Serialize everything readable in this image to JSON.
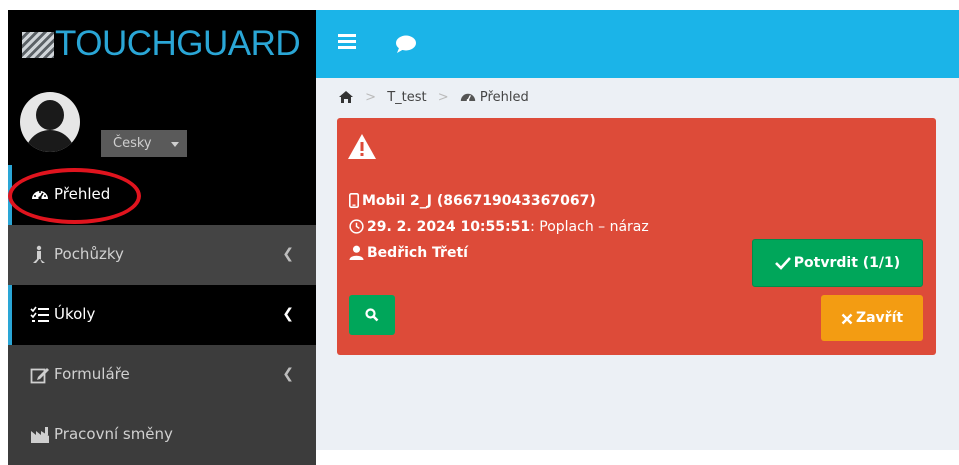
{
  "brand": {
    "name": "TOUCHGUARD"
  },
  "user": {
    "language": "Česky"
  },
  "sidebar": {
    "items": [
      {
        "label": "Přehled",
        "icon": "dashboard-icon",
        "active": true
      },
      {
        "label": "Pochůzky",
        "icon": "walker-icon"
      },
      {
        "label": "Úkoly",
        "icon": "tasks-icon",
        "active": true
      },
      {
        "label": "Formuláře",
        "icon": "edit-icon"
      },
      {
        "label": "Pracovní směny",
        "icon": "chart-icon"
      }
    ]
  },
  "breadcrumb": {
    "home_icon": "home-icon",
    "items": [
      "T_test",
      "Přehled"
    ]
  },
  "alert": {
    "device": "Mobil 2_J (866719043367067)",
    "timestamp": "29. 2. 2024 10:55:51",
    "event": ": Poplach – náraz",
    "person": "Bedřich Třetí",
    "confirm_label": "Potvrdit (1/1)",
    "close_label": "Zavřít"
  },
  "colors": {
    "topbar": "#1bb4e8",
    "alert": "#dd4b39",
    "confirm": "#00a65a",
    "close": "#f39c12",
    "highlight_ring": "#e0141e"
  }
}
